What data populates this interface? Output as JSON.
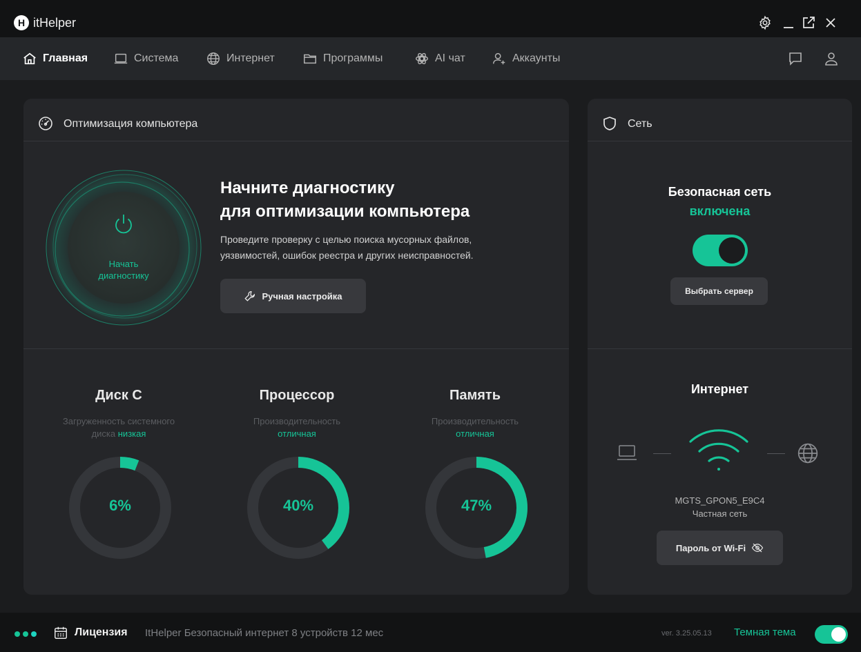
{
  "app": {
    "title": "itHelper",
    "logo_letter": "H"
  },
  "window": {
    "icons": [
      "gear-icon",
      "minimize-icon",
      "popout-icon",
      "close-icon"
    ]
  },
  "nav": {
    "items": [
      {
        "label": "Главная",
        "icon": "home-icon",
        "active": true
      },
      {
        "label": "Система",
        "icon": "laptop-icon"
      },
      {
        "label": "Интернет",
        "icon": "globe-icon"
      },
      {
        "label": "Программы",
        "icon": "folder-icon"
      },
      {
        "label": "AI чат",
        "icon": "ai-icon"
      },
      {
        "label": "Аккаунты",
        "icon": "add-user-icon"
      }
    ],
    "right_icons": [
      "chat-icon",
      "user-icon"
    ]
  },
  "optimization": {
    "title": "Оптимизация компьютера",
    "diag_button": {
      "line1": "Начать",
      "line2": "диагностику"
    },
    "headline_1": "Начните диагностику",
    "headline_2": "для оптимизации компьютера",
    "desc_1": "Проведите проверку с целью поиска мусорных файлов,",
    "desc_2": "уязвимостей, ошибок реестра и других неисправностей.",
    "manual_button": "Ручная настройка"
  },
  "metrics": [
    {
      "title": "Диск C",
      "sub_1": "Загруженность системного",
      "sub_2_prefix": "диска ",
      "sub_2_highlight": "низкая",
      "percent": 6,
      "percent_label": "6%"
    },
    {
      "title": "Процессор",
      "sub_1": "Производительность",
      "sub_2_prefix": "",
      "sub_2_highlight": "отличная",
      "percent": 40,
      "percent_label": "40%"
    },
    {
      "title": "Память",
      "sub_1": "Производительность",
      "sub_2_prefix": "",
      "sub_2_highlight": "отличная",
      "percent": 47,
      "percent_label": "47%"
    }
  ],
  "network": {
    "title": "Сеть",
    "safe_title": "Безопасная сеть",
    "safe_status": "включена",
    "safe_enabled": true,
    "server_button": "Выбрать сервер",
    "internet_title": "Интернет",
    "wifi_name": "MGTS_GPON5_E9C4",
    "wifi_type": "Частная сеть",
    "wifi_password_button": "Пароль от Wi-Fi"
  },
  "status": {
    "license_label": "Лицензия",
    "license_text": "ItHelper Безопасный интернет 8 устройств 12 мес",
    "version": "ver. 3.25.05.13",
    "theme_label": "Темная тема",
    "dark_theme": true
  },
  "colors": {
    "accent": "#16c497",
    "background": "#1b1c1e",
    "card": "#252629",
    "titlebar": "#121314",
    "track": "#34363a"
  }
}
